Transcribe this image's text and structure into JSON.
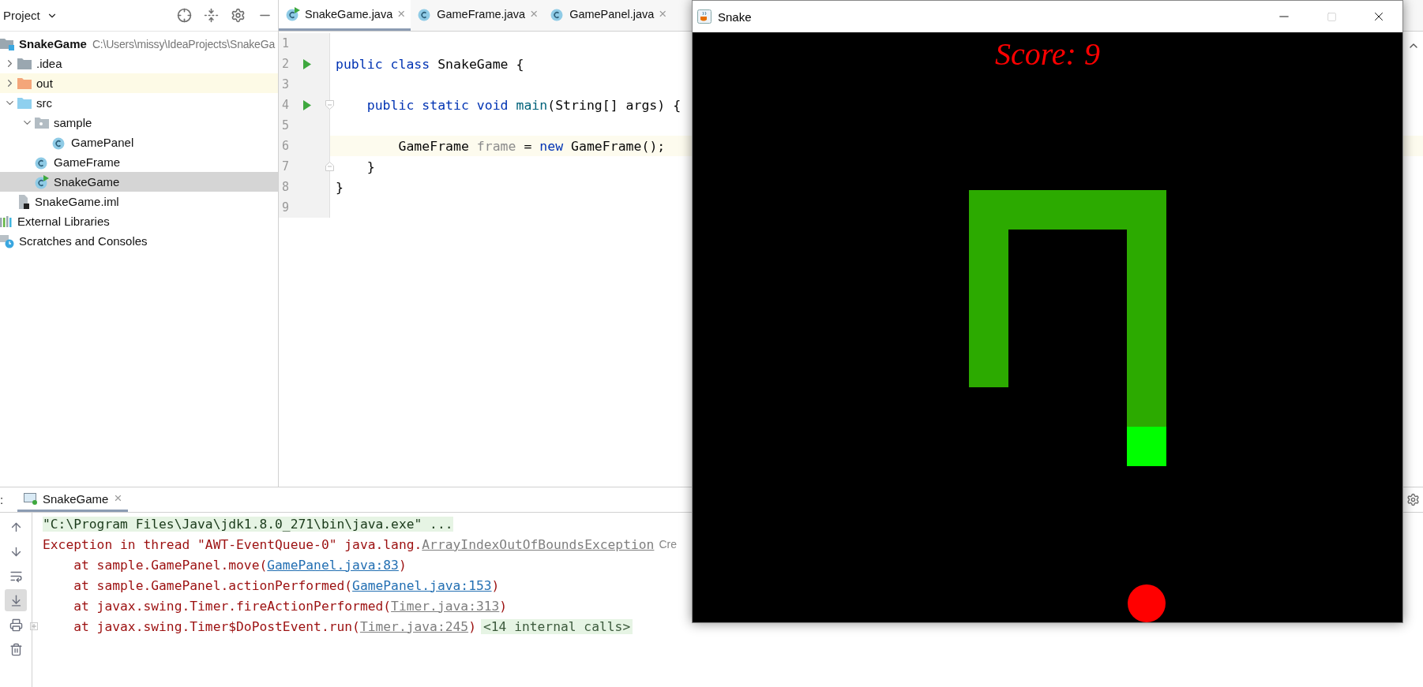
{
  "project": {
    "title": "Project",
    "tree": [
      {
        "name": "SnakeGame",
        "path": "C:\\Users\\missy\\IdeaProjects\\SnakeGa",
        "kind": "module",
        "selected": false,
        "highlighted": false,
        "children": [
          {
            "name": ".idea",
            "kind": "folder",
            "expanded": false,
            "selected": false,
            "highlighted": false
          },
          {
            "name": "out",
            "kind": "excluded",
            "expanded": false,
            "selected": false,
            "highlighted": true
          },
          {
            "name": "src",
            "kind": "source",
            "expanded": true,
            "selected": false,
            "highlighted": false,
            "children": [
              {
                "name": "sample",
                "kind": "package",
                "expanded": true,
                "selected": false,
                "highlighted": false,
                "children": [
                  {
                    "name": "GamePanel",
                    "kind": "class",
                    "selected": false,
                    "highlighted": false
                  }
                ]
              },
              {
                "name": "GameFrame",
                "kind": "class",
                "selected": false,
                "highlighted": false
              },
              {
                "name": "SnakeGame",
                "kind": "class-main",
                "selected": true,
                "highlighted": false
              }
            ]
          },
          {
            "name": "SnakeGame.iml",
            "kind": "module-file",
            "selected": false,
            "highlighted": false
          }
        ]
      },
      {
        "name": "External Libraries",
        "kind": "libraries",
        "selected": false,
        "highlighted": false
      },
      {
        "name": "Scratches and Consoles",
        "kind": "scratches",
        "selected": false,
        "highlighted": false
      }
    ]
  },
  "editor": {
    "tabs": [
      {
        "label": "SnakeGame.java",
        "close": "×",
        "kind": "class-main",
        "selected": true
      },
      {
        "label": "GameFrame.java",
        "close": "×",
        "kind": "class",
        "selected": false
      },
      {
        "label": "GamePanel.java",
        "close": "×",
        "kind": "class",
        "selected": false
      }
    ],
    "lines": [
      {
        "number": "1",
        "runnable": false,
        "current": false
      },
      {
        "number": "2",
        "runnable": true,
        "current": false,
        "tokens": [
          {
            "text": "public class ",
            "kind": "keyword"
          },
          {
            "text": "SnakeGame {",
            "kind": "plain"
          }
        ]
      },
      {
        "number": "3",
        "runnable": false,
        "current": false
      },
      {
        "number": "4",
        "runnable": true,
        "current": false,
        "fold": {
          "kind": "start"
        },
        "tokens": [
          {
            "text": "    public static void ",
            "kind": "keyword"
          },
          {
            "text": "main",
            "kind": "method"
          },
          {
            "text": "(String[] args) {",
            "kind": "plain"
          }
        ]
      },
      {
        "number": "5",
        "runnable": false,
        "current": false
      },
      {
        "number": "6",
        "runnable": false,
        "current": true,
        "tokens": [
          {
            "text": "        GameFrame ",
            "kind": "plain"
          },
          {
            "text": "frame",
            "kind": "unused"
          },
          {
            "text": " = ",
            "kind": "plain"
          },
          {
            "text": "new ",
            "kind": "keyword"
          },
          {
            "text": "GameFrame();",
            "kind": "plain"
          }
        ]
      },
      {
        "number": "7",
        "runnable": false,
        "current": false,
        "fold": {
          "kind": "end"
        },
        "tokens": [
          {
            "text": "    }",
            "kind": "plain"
          }
        ]
      },
      {
        "number": "8",
        "runnable": false,
        "current": false,
        "tokens": [
          {
            "text": "}",
            "kind": "plain"
          }
        ]
      },
      {
        "number": "9",
        "runnable": false,
        "current": false
      }
    ]
  },
  "run": {
    "label": ":",
    "tabs": [
      {
        "label": "SnakeGame",
        "close": "×",
        "selected": true
      }
    ],
    "tools": [
      {
        "kind": "up",
        "selected": false
      },
      {
        "kind": "down",
        "selected": false
      },
      {
        "kind": "wrap",
        "selected": false
      },
      {
        "kind": "scroll-end",
        "selected": true
      },
      {
        "kind": "print",
        "selected": false
      },
      {
        "kind": "trash",
        "selected": false
      }
    ],
    "lines": [
      {
        "kind": "command",
        "foldable": false,
        "parts": [
          {
            "text": "\"C:\\Program Files\\Java\\jdk1.8.0_271\\bin\\java.exe\" ...",
            "kind": "text"
          }
        ]
      },
      {
        "kind": "error",
        "foldable": false,
        "parts": [
          {
            "text": "Exception in thread \"AWT-EventQueue-0\" java.lang.",
            "kind": "text"
          },
          {
            "text": "ArrayIndexOutOfBoundsException",
            "kind": "lib-link"
          },
          {
            "text": "Cre",
            "kind": "hint"
          }
        ]
      },
      {
        "kind": "error",
        "foldable": false,
        "parts": [
          {
            "text": "    at sample.GamePanel.move(",
            "kind": "text"
          },
          {
            "text": "GamePanel.java:83",
            "kind": "link"
          },
          {
            "text": ")",
            "kind": "text"
          }
        ]
      },
      {
        "kind": "error",
        "foldable": false,
        "parts": [
          {
            "text": "    at sample.GamePanel.actionPerformed(",
            "kind": "text"
          },
          {
            "text": "GamePanel.java:153",
            "kind": "link"
          },
          {
            "text": ")",
            "kind": "text"
          }
        ]
      },
      {
        "kind": "error",
        "foldable": false,
        "parts": [
          {
            "text": "    at javax.swing.Timer.fireActionPerformed(",
            "kind": "text"
          },
          {
            "text": "Timer.java:313",
            "kind": "lib-link"
          },
          {
            "text": ")",
            "kind": "text"
          }
        ]
      },
      {
        "kind": "error",
        "foldable": true,
        "parts": [
          {
            "text": "    at javax.swing.Timer$DoPostEvent.run(",
            "kind": "text"
          },
          {
            "text": "Timer.java:245",
            "kind": "lib-link"
          },
          {
            "text": ")",
            "kind": "text"
          },
          {
            "text": "<14 internal calls>",
            "kind": "folded"
          }
        ]
      }
    ]
  },
  "game_window": {
    "title": "Snake",
    "controls": [
      {
        "kind": "minimize",
        "disabled": false
      },
      {
        "kind": "maximize",
        "disabled": true
      },
      {
        "kind": "close",
        "disabled": false
      }
    ],
    "score": "Score: 9"
  }
}
